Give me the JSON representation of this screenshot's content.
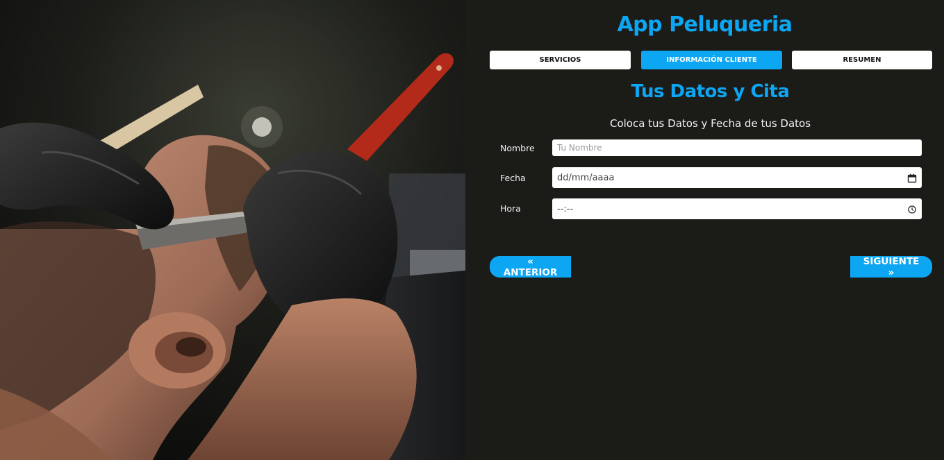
{
  "app": {
    "title": "App Peluqueria"
  },
  "tabs": [
    {
      "label": "Servicios",
      "active": false
    },
    {
      "label": "Información Cliente",
      "active": true
    },
    {
      "label": "Resumen",
      "active": false
    }
  ],
  "section": {
    "title": "Tus Datos y Cita",
    "subtitle": "Coloca tus Datos y Fecha de tus Datos"
  },
  "form": {
    "nombre": {
      "label": "Nombre",
      "placeholder": "Tu Nombre",
      "value": ""
    },
    "fecha": {
      "label": "Fecha",
      "display": "dd/mm/aaaa",
      "icon": "calendar-icon"
    },
    "hora": {
      "label": "Hora",
      "display": "--:--",
      "icon": "clock-icon"
    }
  },
  "nav": {
    "prev_label": "« ANTERIOR",
    "next_label": "SIGUIENTE »"
  },
  "colors": {
    "accent": "#0da6f2",
    "background": "#1b1b18",
    "tab_inactive": "#ffffff"
  },
  "hero_image": {
    "icon": "barber-photo"
  }
}
